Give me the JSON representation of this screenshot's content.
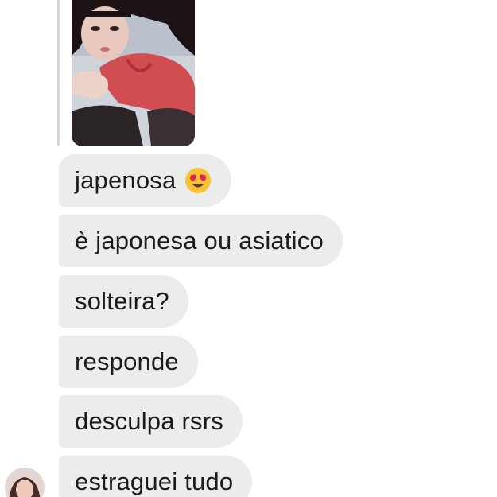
{
  "messages": [
    {
      "text": "japenosa",
      "emoji": "heart-eyes-emoji"
    },
    {
      "text": "è japonesa ou asiatico"
    },
    {
      "text": "solteira?"
    },
    {
      "text": "responde"
    },
    {
      "text": "desculpa rsrs"
    },
    {
      "text": "estraguei tudo"
    }
  ],
  "colors": {
    "bubble": "#ececec",
    "text": "#1b1b1b",
    "thread_line": "#d6d6d6"
  }
}
